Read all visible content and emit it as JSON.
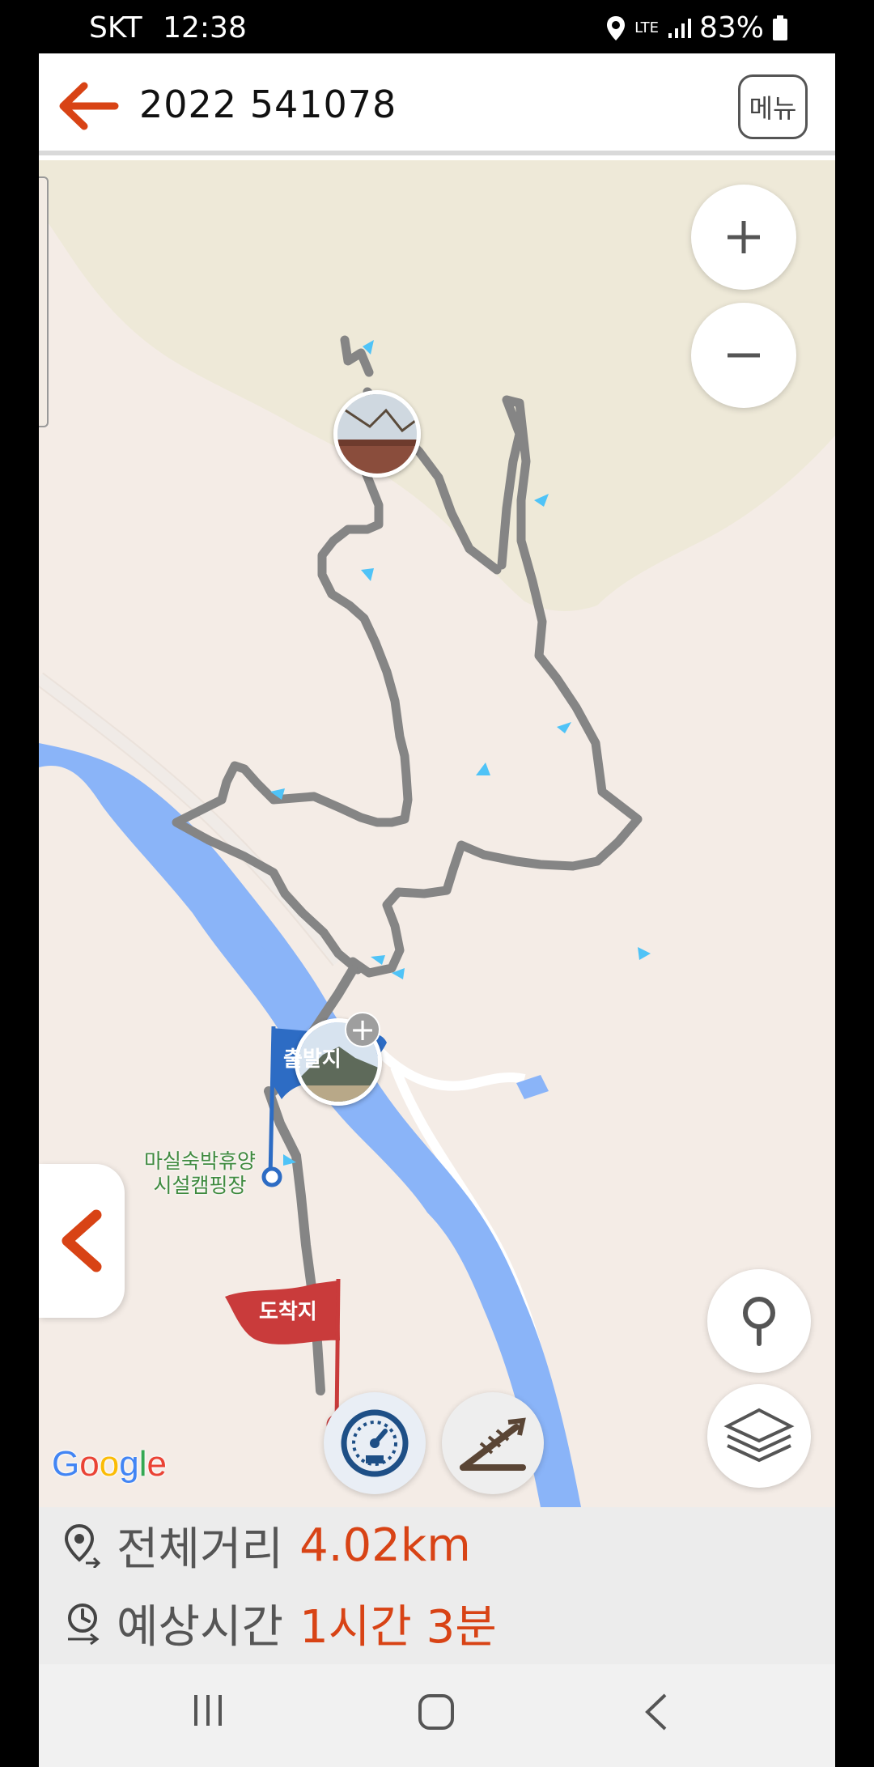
{
  "status_bar": {
    "carrier": "SKT",
    "time": "12:38",
    "network": "LTE",
    "battery": "83%"
  },
  "header": {
    "title": "2022 541078",
    "menu_label": "메뉴"
  },
  "map": {
    "start_flag": "출발지",
    "end_flag": "도착지",
    "place_label": "마실숙박휴양\n시설캠핑장",
    "attribution": "Google",
    "route_color": "#888888",
    "water_color": "#8ab4f8"
  },
  "info": {
    "distance_label": "전체거리",
    "distance_value": "4.02km",
    "time_label": "예상시간",
    "time_value": "1시간 3분"
  },
  "colors": {
    "accent": "#d84315",
    "start": "#2d6cc4",
    "end": "#c93b3b"
  }
}
